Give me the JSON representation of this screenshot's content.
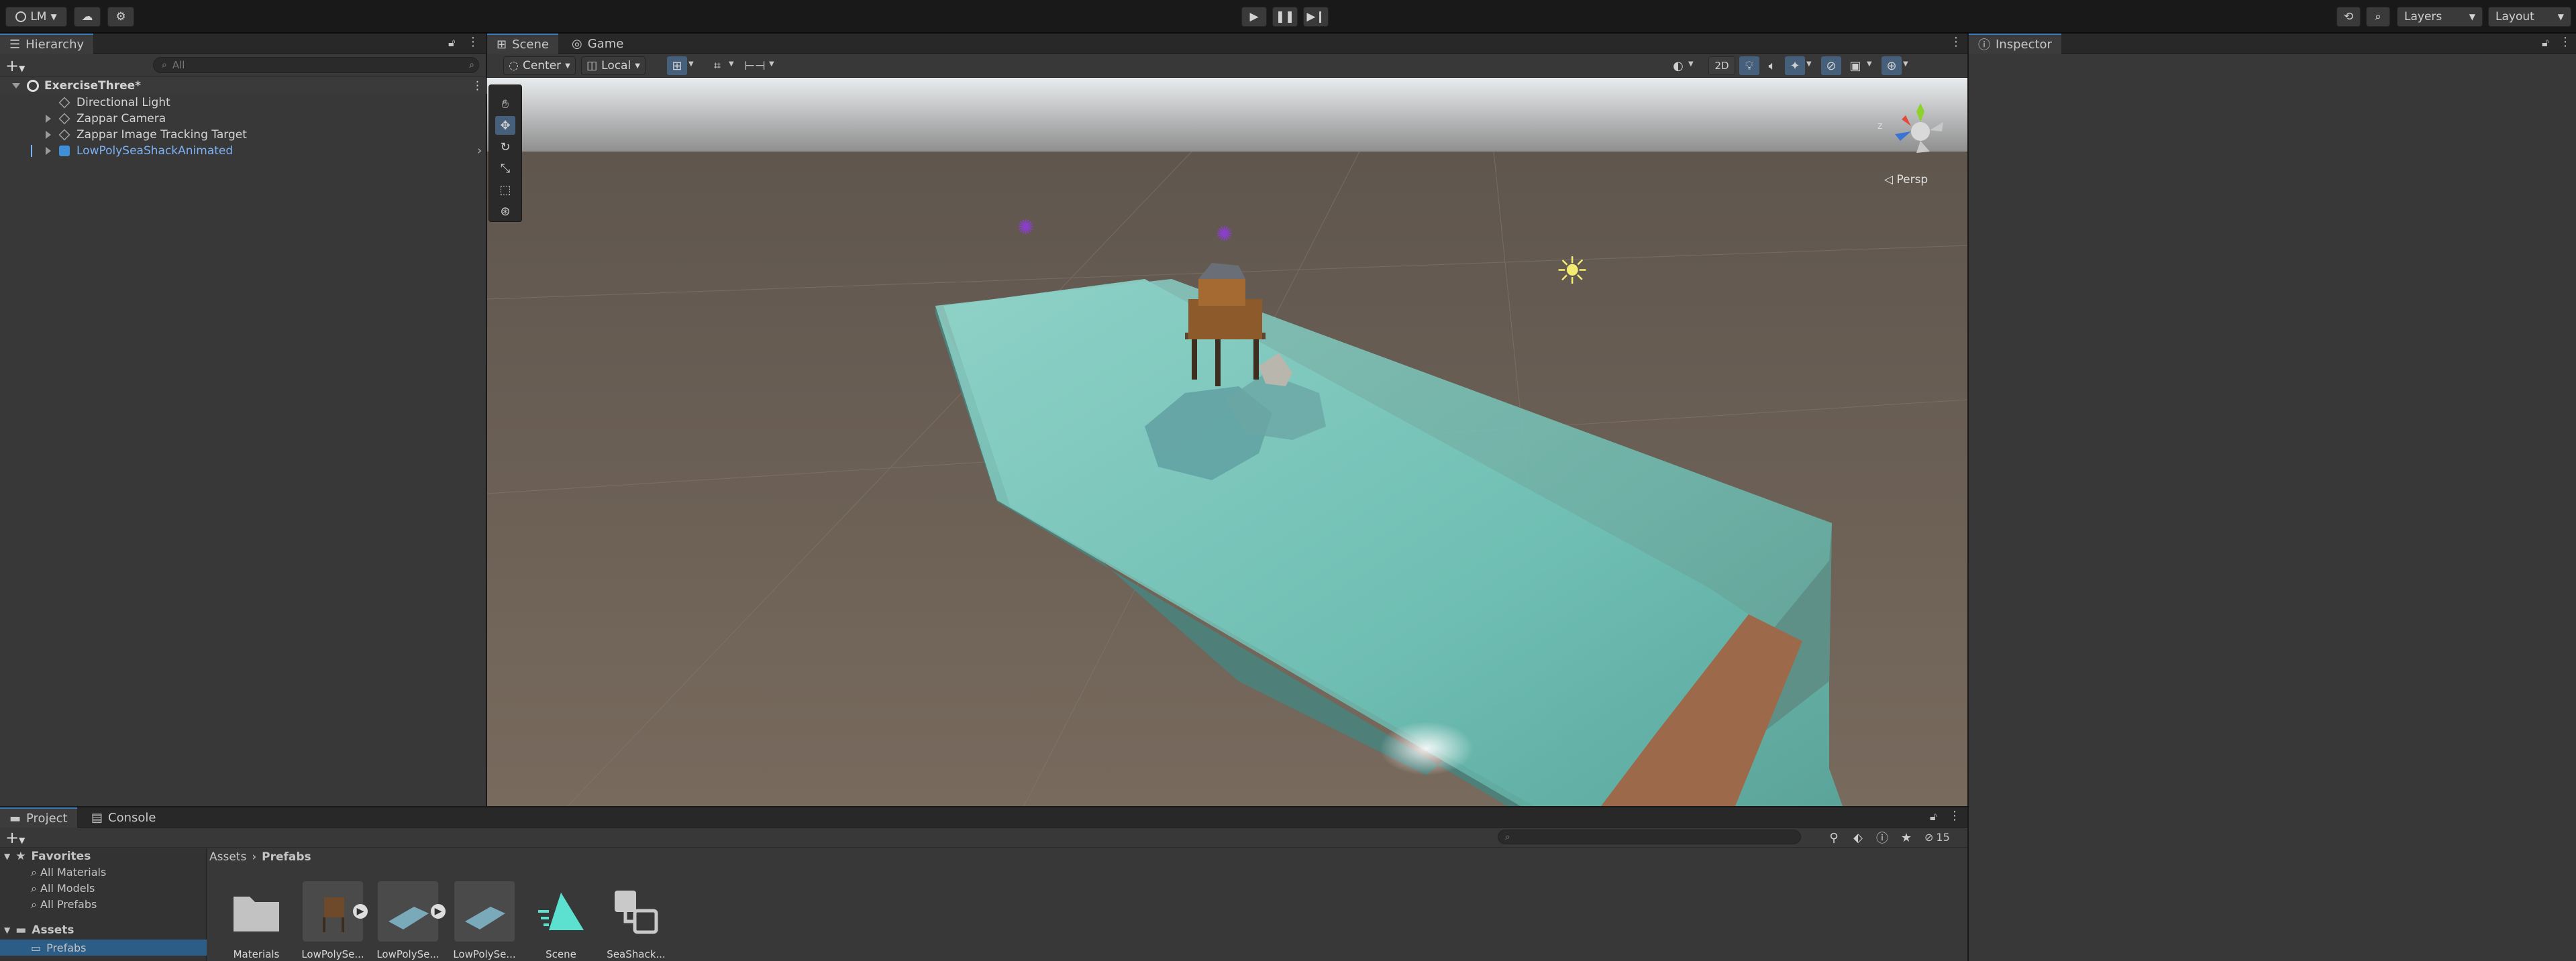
{
  "topbar": {
    "account": "LM",
    "layers": "Layers",
    "layout": "Layout"
  },
  "hierarchy": {
    "tab": "Hierarchy",
    "search_placeholder": "All",
    "scene": "ExerciseThree*",
    "items": [
      {
        "label": "Directional Light",
        "expandable": false
      },
      {
        "label": "Zappar Camera",
        "expandable": true
      },
      {
        "label": "Zappar Image Tracking Target",
        "expandable": true
      },
      {
        "label": "LowPolySeaShackAnimated",
        "expandable": true,
        "prefab": true
      }
    ]
  },
  "scene_view": {
    "tabs": [
      "Scene",
      "Game"
    ],
    "pivot": "Center",
    "space": "Local",
    "mode_2d": "2D",
    "persp": "Persp",
    "gizmo_axis": "z"
  },
  "inspector": {
    "tab": "Inspector"
  },
  "project": {
    "tabs": [
      "Project",
      "Console"
    ],
    "favorites": {
      "title": "Favorites",
      "items": [
        "All Materials",
        "All Models",
        "All Prefabs"
      ]
    },
    "assets_root": "Assets",
    "selected_folder": "Prefabs",
    "breadcrumb": [
      "Assets",
      "Prefabs"
    ],
    "hidden_count": "15",
    "items": [
      {
        "label": "Materials",
        "kind": "folder"
      },
      {
        "label": "LowPolySe...",
        "kind": "model"
      },
      {
        "label": "LowPolySe...",
        "kind": "water-anim"
      },
      {
        "label": "LowPolySe...",
        "kind": "water"
      },
      {
        "label": "Scene",
        "kind": "scene"
      },
      {
        "label": "SeaShack...",
        "kind": "prefab"
      }
    ]
  },
  "colors": {
    "accent": "#3a79bb",
    "prefab": "#7cb1f2",
    "panel": "#383838",
    "water": "#6fc7be",
    "ground": "#6f6459",
    "sky": "#b0b4b8"
  }
}
